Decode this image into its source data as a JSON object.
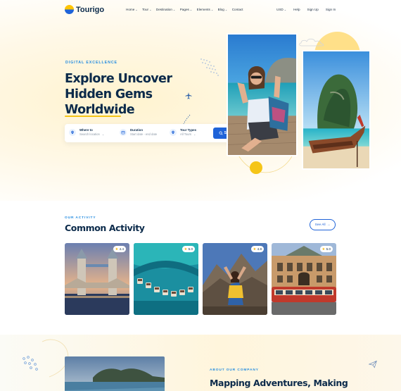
{
  "brand": {
    "name": "Tourigo"
  },
  "nav": {
    "items": [
      {
        "label": "Home",
        "has_dropdown": true
      },
      {
        "label": "Tour",
        "has_dropdown": true
      },
      {
        "label": "Destination",
        "has_dropdown": true
      },
      {
        "label": "Pages",
        "has_dropdown": true
      },
      {
        "label": "Elements",
        "has_dropdown": true
      },
      {
        "label": "Blog",
        "has_dropdown": true
      },
      {
        "label": "Contact",
        "has_dropdown": false
      }
    ],
    "currency": "USD",
    "help": "Help",
    "sign_up": "Sign Up",
    "sign_in": "Sign In"
  },
  "hero": {
    "eyebrow": "DIGITAL EXCELLENCE",
    "title_line1": "Explore Uncover",
    "title_line2": "Hidden Gems",
    "title_line3": "Worldwide"
  },
  "search": {
    "where_label": "Where to",
    "where_value": "Search location",
    "duration_label": "Duration",
    "duration_value": "Start date - end date",
    "tour_label": "Tour Types",
    "tour_value": "All Tours",
    "button_label": "Search"
  },
  "activity": {
    "eyebrow": "OUR ACTIVITY",
    "title": "Common Activity",
    "see_all": "See All",
    "cards": [
      {
        "rating": "4.4"
      },
      {
        "rating": "5.0"
      },
      {
        "rating": "4.8"
      },
      {
        "rating": "5.0"
      }
    ]
  },
  "about": {
    "eyebrow": "ABOUT OUR COMPANY",
    "title": "Mapping Adventures, Making"
  },
  "colors": {
    "primary": "#1f63d8",
    "accent_yellow": "#f5c518",
    "heading": "#0b2a4a",
    "eyebrow": "#1f8ae0"
  }
}
